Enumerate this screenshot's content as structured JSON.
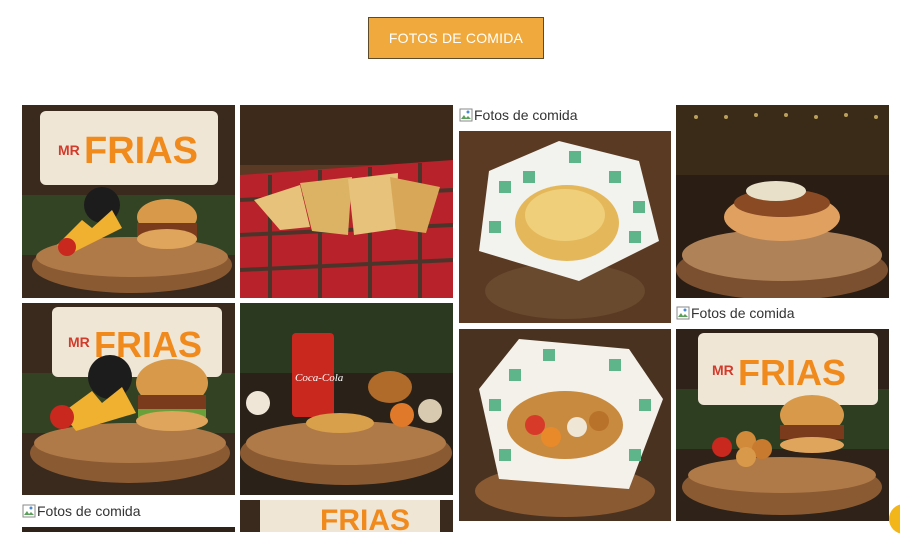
{
  "header": {
    "button_label": "FOTOS DE COMIDA"
  },
  "gallery": {
    "alt_text": "Fotos de comida",
    "sign_text": "FRIAS",
    "sign_prefix": "MR",
    "drink_label": "Coca-Cola"
  },
  "colors": {
    "accent": "#f0a93c",
    "wood": "#8a5a33",
    "dark_bg": "#2a1d14",
    "checker_green": "#5fb58a",
    "sign_orange": "#f08a1c",
    "sign_red": "#d43a2a"
  }
}
